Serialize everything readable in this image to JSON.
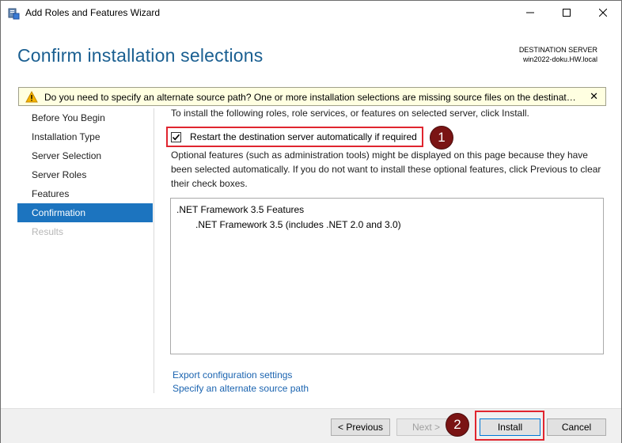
{
  "window": {
    "title": "Add Roles and Features Wizard",
    "icon": "server-manager-icon",
    "controls": [
      "minimize-icon",
      "maximize-icon",
      "close-icon"
    ]
  },
  "header": {
    "page_title": "Confirm installation selections",
    "destination_label": "DESTINATION SERVER",
    "destination_value": "win2022-doku.HW.local"
  },
  "warning": {
    "icon": "warning-icon",
    "text": "Do you need to specify an alternate source path? One or more installation selections are missing source files on the destination server.",
    "close_label": "✕"
  },
  "sidebar": {
    "items": [
      {
        "label": "Before You Begin",
        "state": "normal"
      },
      {
        "label": "Installation Type",
        "state": "normal"
      },
      {
        "label": "Server Selection",
        "state": "normal"
      },
      {
        "label": "Server Roles",
        "state": "normal"
      },
      {
        "label": "Features",
        "state": "normal"
      },
      {
        "label": "Confirmation",
        "state": "active"
      },
      {
        "label": "Results",
        "state": "disabled"
      }
    ]
  },
  "main": {
    "intro": "To install the following roles, role services, or features on selected server, click Install.",
    "restart_checkbox": {
      "label": "Restart the destination server automatically if required",
      "checked": true
    },
    "optional_text": "Optional features (such as administration tools) might be displayed on this page because they have been selected automatically. If you do not want to install these optional features, click Previous to clear their check boxes.",
    "features": {
      "parent": ".NET Framework 3.5 Features",
      "child": ".NET Framework 3.5 (includes .NET 2.0 and 3.0)"
    },
    "links": {
      "export": "Export configuration settings",
      "alt_source": "Specify an alternate source path"
    }
  },
  "annotations": {
    "badge1": "1",
    "badge2": "2",
    "color": "#e0252f"
  },
  "footer": {
    "previous": "< Previous",
    "next": "Next >",
    "install": "Install",
    "cancel": "Cancel"
  },
  "colors": {
    "title_blue": "#1a5f91",
    "active_nav": "#1c74bf",
    "link": "#1b64b0",
    "warning_bg": "#ffffe1"
  }
}
